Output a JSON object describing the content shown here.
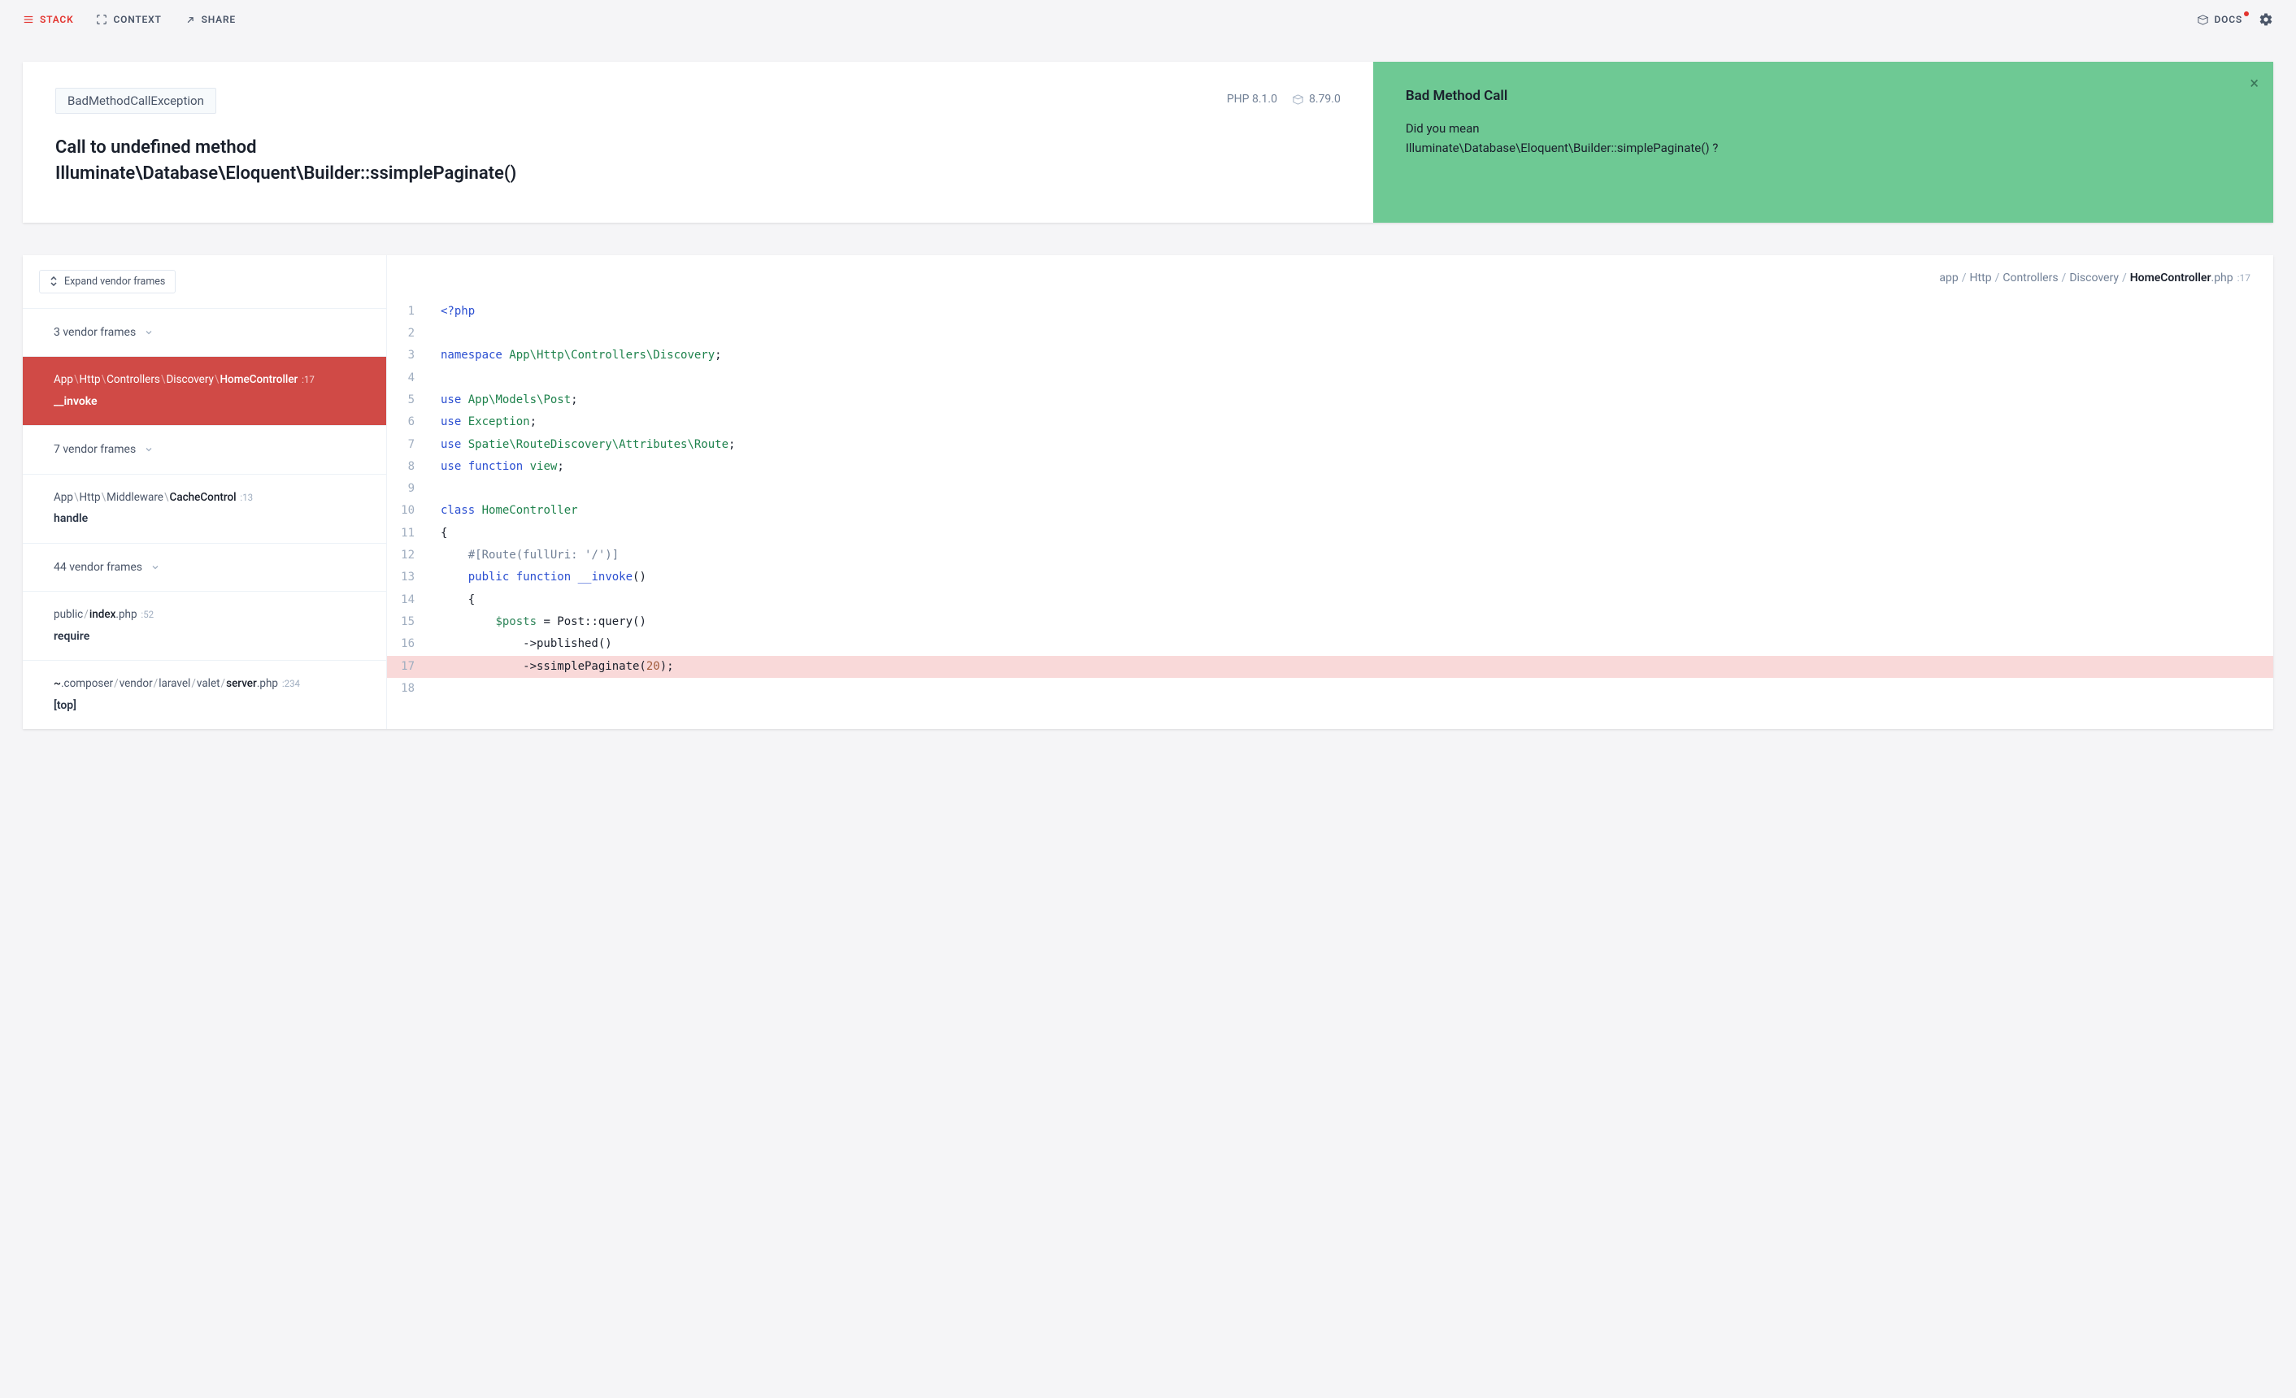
{
  "topbar": {
    "stack": "STACK",
    "context": "CONTEXT",
    "share": "SHARE",
    "docs": "DOCS"
  },
  "hero": {
    "exception": "BadMethodCallException",
    "php_version": "PHP 8.1.0",
    "laravel_version": "8.79.0",
    "title_line1": "Call to undefined method",
    "title_line2": "Illuminate\\Database\\Eloquent\\Builder::ssimplePaginate()"
  },
  "solution": {
    "title": "Bad Method Call",
    "lead": "Did you mean",
    "suggestion": "Illuminate\\Database\\Eloquent\\Builder::simplePaginate() ?"
  },
  "frames": {
    "expand_label": "Expand vendor frames",
    "items": [
      {
        "type": "vendor",
        "label": "3 vendor frames"
      },
      {
        "type": "frame",
        "active": true,
        "path_parts": [
          "App",
          "Http",
          "Controllers",
          "Discovery",
          "HomeController"
        ],
        "line": "17",
        "method": "__invoke"
      },
      {
        "type": "vendor",
        "label": "7 vendor frames"
      },
      {
        "type": "frame",
        "path_parts": [
          "App",
          "Http",
          "Middleware",
          "CacheControl"
        ],
        "line": "13",
        "method": "handle"
      },
      {
        "type": "vendor",
        "label": "44 vendor frames"
      },
      {
        "type": "frame",
        "path_parts_file": [
          "public",
          "index",
          ".php"
        ],
        "line": "52",
        "method": "require"
      },
      {
        "type": "frame",
        "path_parts_file": [
          "~",
          ".composer",
          "vendor",
          "laravel",
          "valet",
          "server",
          ".php"
        ],
        "line": "234",
        "method": "[top]"
      }
    ]
  },
  "code_header": {
    "parts": [
      "app",
      "Http",
      "Controllers",
      "Discovery"
    ],
    "file": "HomeController",
    "ext": ".php",
    "line": "17"
  },
  "code_lines": [
    {
      "n": 1,
      "html": "<span class=\"tk-kw\">&lt;?php</span>"
    },
    {
      "n": 2,
      "html": ""
    },
    {
      "n": 3,
      "html": "<span class=\"tk-kw\">namespace</span> <span class=\"tk-ns\">App\\Http\\Controllers\\Discovery</span>;"
    },
    {
      "n": 4,
      "html": ""
    },
    {
      "n": 5,
      "html": "<span class=\"tk-kw\">use</span> <span class=\"tk-ns\">App\\Models\\Post</span>;"
    },
    {
      "n": 6,
      "html": "<span class=\"tk-kw\">use</span> <span class=\"tk-ns\">Exception</span>;"
    },
    {
      "n": 7,
      "html": "<span class=\"tk-kw\">use</span> <span class=\"tk-ns\">Spatie\\RouteDiscovery\\Attributes\\Route</span>;"
    },
    {
      "n": 8,
      "html": "<span class=\"tk-kw\">use</span> <span class=\"tk-kw\">function</span> <span class=\"tk-ns\">view</span>;"
    },
    {
      "n": 9,
      "html": ""
    },
    {
      "n": 10,
      "html": "<span class=\"tk-kw\">class</span> <span class=\"tk-ns\">HomeController</span>"
    },
    {
      "n": 11,
      "html": "{"
    },
    {
      "n": 12,
      "html": "    <span class=\"tk-muted\">#[Route(fullUri: '/')]</span>"
    },
    {
      "n": 13,
      "html": "    <span class=\"tk-kw\">public</span> <span class=\"tk-kw\">function</span> <span class=\"tk-kw\">__invoke</span>()"
    },
    {
      "n": 14,
      "html": "    {"
    },
    {
      "n": 15,
      "html": "        <span class=\"tk-var\">$posts</span> = Post::query()"
    },
    {
      "n": 16,
      "html": "            -&gt;published()"
    },
    {
      "n": 17,
      "hl": true,
      "html": "            -&gt;ssimplePaginate(<span class=\"tk-num\">20</span>);"
    },
    {
      "n": 18,
      "html": ""
    }
  ]
}
